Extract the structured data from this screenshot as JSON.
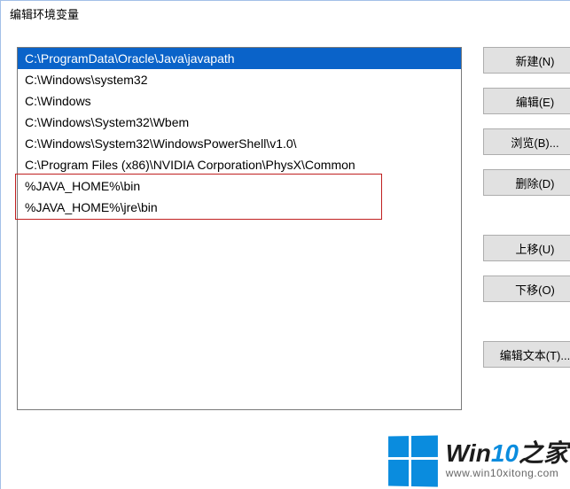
{
  "window": {
    "title": "编辑环境变量"
  },
  "list": {
    "items": [
      "C:\\ProgramData\\Oracle\\Java\\javapath",
      "C:\\Windows\\system32",
      "C:\\Windows",
      "C:\\Windows\\System32\\Wbem",
      "C:\\Windows\\System32\\WindowsPowerShell\\v1.0\\",
      "C:\\Program Files (x86)\\NVIDIA Corporation\\PhysX\\Common",
      "%JAVA_HOME%\\bin",
      "%JAVA_HOME%\\jre\\bin"
    ],
    "selected_index": 0,
    "highlight_indices": [
      6,
      7
    ]
  },
  "buttons": {
    "new": "新建(N)",
    "edit": "编辑(E)",
    "browse": "浏览(B)...",
    "delete": "删除(D)",
    "moveup": "上移(U)",
    "movedown": "下移(O)",
    "edittext": "编辑文本(T)..."
  },
  "watermark": {
    "brand_html_prefix": "Win",
    "brand_html_accent": "10",
    "brand_html_suffix": "之家",
    "url": "www.win10xitong.com"
  }
}
